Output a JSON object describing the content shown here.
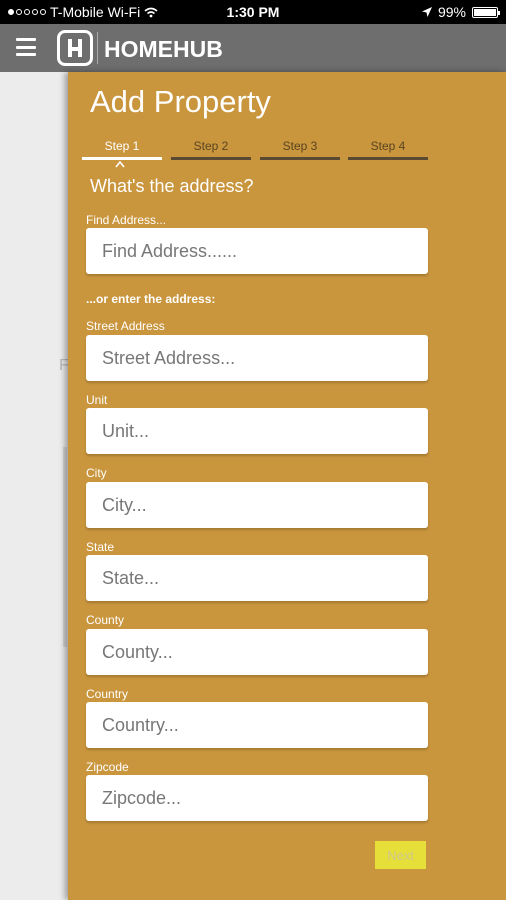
{
  "status_bar": {
    "carrier": "T-Mobile Wi-Fi",
    "time": "1:30 PM",
    "battery": "99%",
    "battery_level": 0.99,
    "signal_bars_filled": 1,
    "signal_bars_total": 5
  },
  "app_bar": {
    "brand": "HOMEHUB",
    "background_color": "#6e6e6e"
  },
  "background_page": {
    "glyph": "F"
  },
  "panel": {
    "background_color": "#c9953d",
    "title": "Add Property",
    "steps": [
      {
        "label": "Step 1",
        "active": true
      },
      {
        "label": "Step 2",
        "active": false
      },
      {
        "label": "Step 3",
        "active": false
      },
      {
        "label": "Step 4",
        "active": false
      }
    ],
    "subtitle": "What's the address?",
    "find_address": {
      "label": "Find Address...",
      "placeholder": "Find Address......",
      "value": ""
    },
    "or_label": "...or enter the address:",
    "fields": {
      "street": {
        "label": "Street Address",
        "placeholder": "Street Address...",
        "value": ""
      },
      "unit": {
        "label": "Unit",
        "placeholder": "Unit...",
        "value": ""
      },
      "city": {
        "label": "City",
        "placeholder": "City...",
        "value": ""
      },
      "state": {
        "label": "State",
        "placeholder": "State...",
        "value": ""
      },
      "county": {
        "label": "County",
        "placeholder": "County...",
        "value": ""
      },
      "country": {
        "label": "Country",
        "placeholder": "Country...",
        "value": ""
      },
      "zipcode": {
        "label": "Zipcode",
        "placeholder": "Zipcode...",
        "value": ""
      }
    },
    "next_label": "Next",
    "next_color": "#e6df3a"
  }
}
